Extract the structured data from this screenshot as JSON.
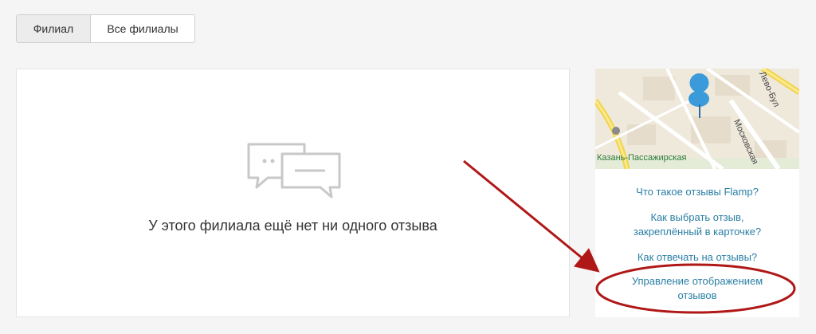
{
  "tabs": [
    {
      "label": "Филиал",
      "active": true
    },
    {
      "label": "Все филиалы",
      "active": false
    }
  ],
  "reviews": {
    "empty_text": "У этого филиала ещё нет ни одного отзыва",
    "empty_icon": "chat-bubbles-icon"
  },
  "map": {
    "station_label": "Казань-Пассажирская",
    "street_1": "Московская",
    "street_2": "Лево-Бул"
  },
  "help_links": [
    "Что такое отзывы Flamp?",
    "Как выбрать отзыв, закреплённый в карточке?",
    "Как отвечать на отзывы?",
    "Управление отображением отзывов"
  ],
  "annotation": {
    "color": "#b01717",
    "target": "Управление отображением отзывов"
  },
  "colors": {
    "link": "#2a7fa5",
    "pin": "#3b9ad9",
    "background": "#f5f5f5"
  }
}
